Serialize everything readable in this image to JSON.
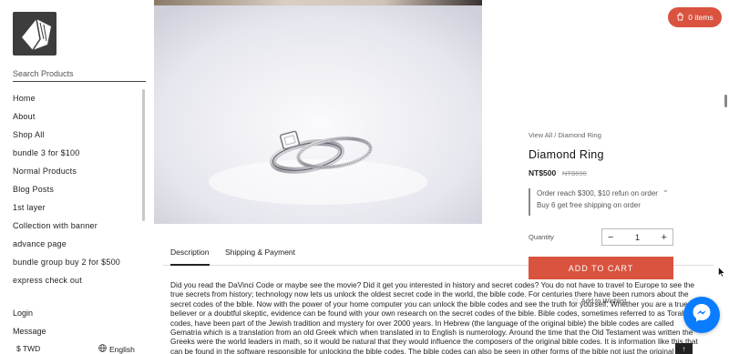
{
  "sidebar": {
    "search_placeholder": "Search Products",
    "items": [
      {
        "label": "Home"
      },
      {
        "label": "About"
      },
      {
        "label": "Shop All"
      },
      {
        "label": "bundle 3 for $100"
      },
      {
        "label": "Normal Products"
      },
      {
        "label": "Blog Posts"
      },
      {
        "label": "1st layer"
      },
      {
        "label": "Collection with banner"
      },
      {
        "label": "advance page"
      },
      {
        "label": "bundle group buy 2 for $500"
      },
      {
        "label": "express check out"
      }
    ],
    "login": "Login",
    "message": "Message",
    "currency": "$ TWD",
    "language": "English"
  },
  "header": {
    "cart_label": "0 items"
  },
  "product": {
    "breadcrumb": "View All / Diamond Ring",
    "title": "Diamond Ring",
    "price": "NT$500",
    "old_price": "NT$690",
    "promo_line1": "Order reach $300, $10 refun on order",
    "promo_line2": "Buy 6 get free shipping on order",
    "quantity_label": "Quantity",
    "quantity_value": "1",
    "add_to_cart": "ADD TO CART",
    "wishlist": "Add to Wishlist"
  },
  "tabs": [
    {
      "label": "Description",
      "active": true
    },
    {
      "label": "Shipping & Payment",
      "active": false
    }
  ],
  "description": "Did you read the DaVinci Code or maybe see the movie? Did it get you interested in history and secret codes? You do not have to travel to Europe to see the true secrets from history; technology now lets us unlock the oldest secret code in the world, the bible code. For centuries there have been rumors about the secret codes of the bible. Now with the power of your home computer you can unlock the bible codes and see the truth for yourself. Whether you are a true believer or a doubtful skeptic, evidence can be found with your own research on the secret codes of the bible. Bible codes, sometimes referred to as Torah codes, have been part of the Jewish tradition and mystery for over 2000 years. In Hebrew (the language of the original bible) the bible codes are called Gematria which is a translation from an old Greek which when translated in to English is numerology. Around the time that the Old Testament was written the Greeks were the world leaders in math, so it would be natural that they would influence the composers of the original bible codes. It is information like this that can be found in the software responsible for unlocking the bible codes. The bible codes can also be seen in other forms of the bible not just the original Hebrew. The King James Version has hidden bible codes and mystery",
  "colors": {
    "accent": "#d9533f",
    "messenger": "#0a7cff"
  }
}
